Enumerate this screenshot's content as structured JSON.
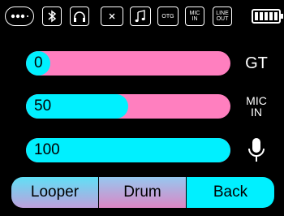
{
  "status_bar": {
    "icons": [
      "more-icon",
      "bluetooth-icon",
      "headphones-icon",
      "close-icon",
      "music-note-icon",
      "otg-icon",
      "mic-in-icon",
      "line-out-icon",
      "battery-icon"
    ],
    "otg_label": "OTG",
    "mic_in_label_1": "MIC",
    "mic_in_label_2": "IN",
    "line_out_label_1": "LINE",
    "line_out_label_2": "OUT",
    "battery_level": 1.0
  },
  "sliders": [
    {
      "value": "0",
      "fraction": 0.0,
      "label": "GT"
    },
    {
      "value": "50",
      "fraction": 0.5,
      "label_1": "MIC",
      "label_2": "IN"
    },
    {
      "value": "100",
      "fraction": 1.0,
      "icon": "microphone-icon"
    }
  ],
  "bottom_buttons": {
    "looper": "Looper",
    "drum": "Drum",
    "back": "Back"
  },
  "colors": {
    "background": "#000000",
    "track": "#ff7fbf",
    "fill": "#00f0ff",
    "text_on_fill": "#000000",
    "icon": "#ffffff"
  }
}
